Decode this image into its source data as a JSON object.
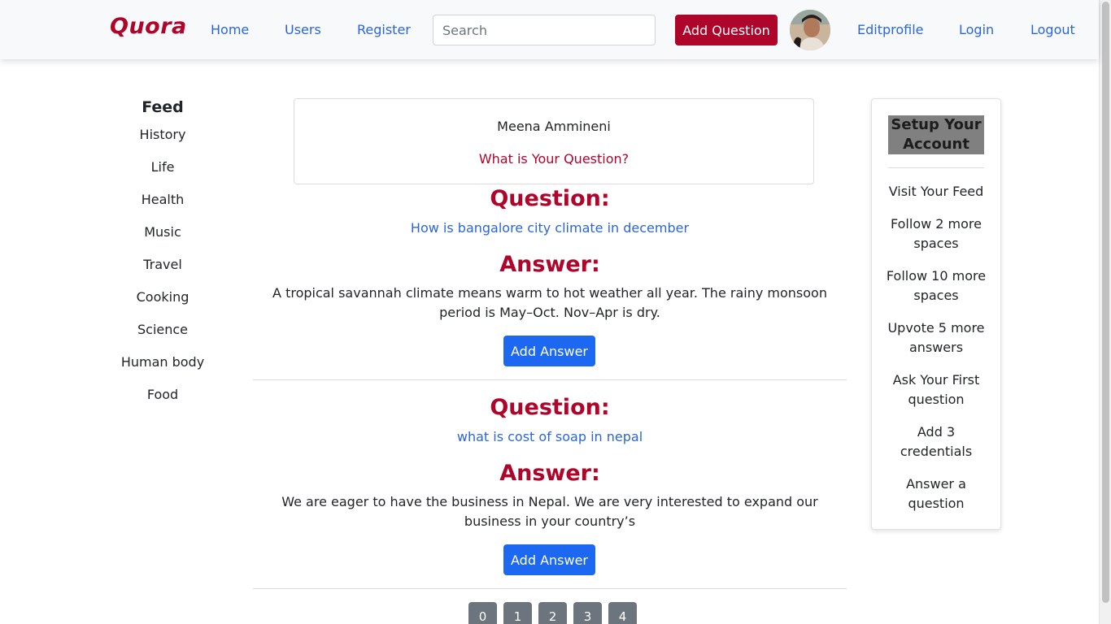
{
  "navbar": {
    "brand": "Quora",
    "links": {
      "home": "Home",
      "users": "Users",
      "register": "Register",
      "editprofile": "Editprofile",
      "login": "Login",
      "logout": "Logout"
    },
    "search": {
      "placeholder": "Search",
      "value": ""
    },
    "add_question": "Add Question"
  },
  "feed": {
    "title": "Feed",
    "items": [
      "History",
      "Life",
      "Health",
      "Music",
      "Travel",
      "Cooking",
      "Science",
      "Human body",
      "Food"
    ]
  },
  "user_card": {
    "name": "Meena Ammineni",
    "prompt": "What is Your Question?"
  },
  "posts": [
    {
      "question_heading": "Question:",
      "question": "How is bangalore city climate in december",
      "answer_heading": "Answer:",
      "answer": "A tropical savannah climate means warm to hot weather all year. The rainy monsoon period is May–Oct. Nov–Apr is dry.",
      "add_answer": "Add Answer"
    },
    {
      "question_heading": "Question:",
      "question": "what is cost of soap in nepal",
      "answer_heading": "Answer:",
      "answer": "We are eager to have the business in Nepal. We are very interested to expand our business in your country’s",
      "add_answer": "Add Answer"
    }
  ],
  "pagination": [
    "0",
    "1",
    "2",
    "3",
    "4"
  ],
  "setup": {
    "title": "Setup Your Account",
    "items": [
      "Visit Your Feed",
      "Follow 2 more spaces",
      "Follow 10 more spaces",
      "Upvote 5 more answers",
      "Ask Your First question",
      "Add 3 credentials",
      "Answer a question"
    ]
  },
  "colors": {
    "brand": "#b0052b",
    "link": "#2b66d6",
    "primary_button": "#1d68f0",
    "pagination": "#6c757d"
  }
}
